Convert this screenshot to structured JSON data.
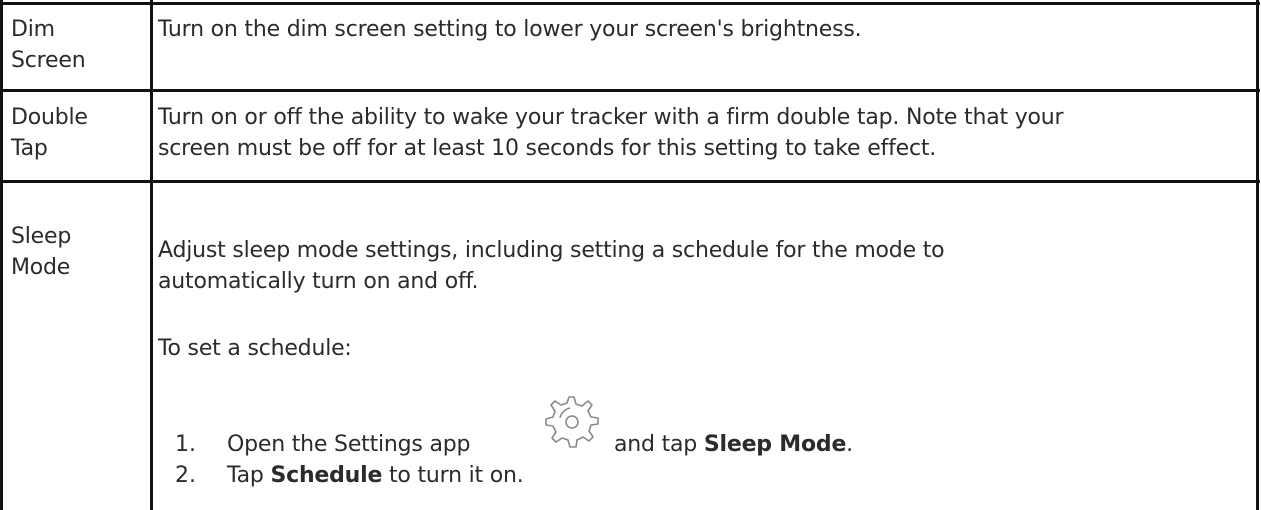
{
  "rows": [
    {
      "term": [
        "Dim",
        "Screen"
      ],
      "description": "Turn on the dim screen setting to lower your screen's brightness."
    },
    {
      "term": [
        "Double",
        "Tap"
      ],
      "description_lines": [
        "Turn on or off the ability to wake your tracker with a firm double tap. Note that your",
        "screen must be off for at least 10 seconds for this setting to take effect."
      ]
    },
    {
      "term": [
        "Sleep",
        "Mode"
      ],
      "description_lines": [
        "Adjust sleep mode settings, including setting a schedule for the mode to",
        "automatically turn on and off."
      ],
      "schedule_intro": "To set a schedule:",
      "steps": [
        {
          "number": "1.",
          "before": "Open the Settings app",
          "icon": "settings-gear-icon",
          "middle": "and tap",
          "bold": "Sleep Mode",
          "after": "."
        },
        {
          "number": "2.",
          "before": "Tap",
          "bold": "Schedule",
          "after": "to turn it on."
        }
      ]
    }
  ]
}
